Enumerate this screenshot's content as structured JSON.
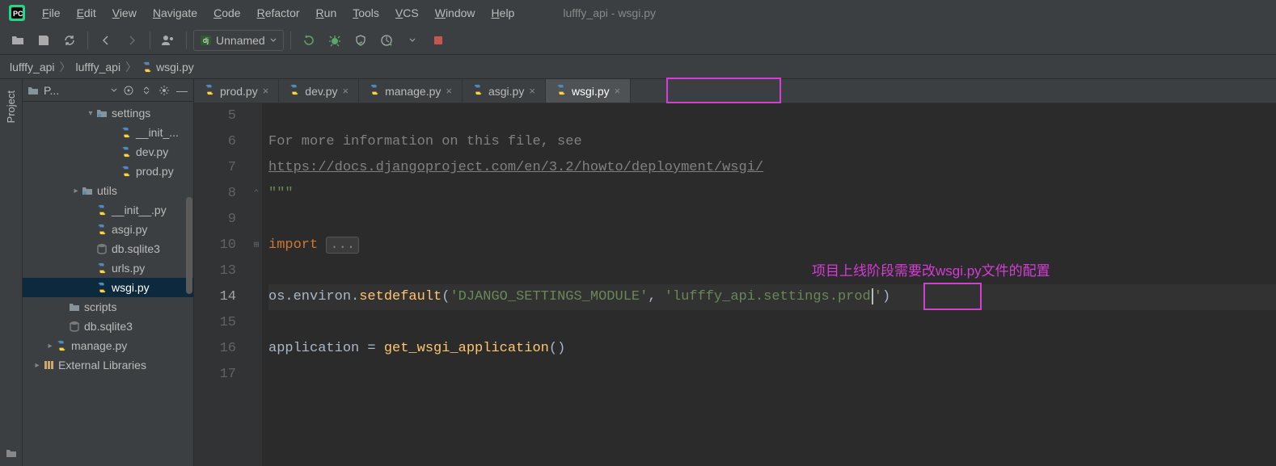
{
  "menu": {
    "items": [
      "File",
      "Edit",
      "View",
      "Navigate",
      "Code",
      "Refactor",
      "Run",
      "Tools",
      "VCS",
      "Window",
      "Help"
    ]
  },
  "window_title": "lufffy_api - wsgi.py",
  "run_config": {
    "label": "Unnamed",
    "badge": "dj"
  },
  "breadcrumbs": {
    "items": [
      "lufffy_api",
      "lufffy_api",
      "wsgi.py"
    ]
  },
  "project_panel": {
    "title": "P..."
  },
  "side_tab": {
    "label": "Project"
  },
  "tree": [
    {
      "pad": 78,
      "kind": "folder",
      "label": "settings",
      "arrow": "down"
    },
    {
      "pad": 108,
      "kind": "py",
      "label": "__init_..."
    },
    {
      "pad": 108,
      "kind": "py",
      "label": "dev.py"
    },
    {
      "pad": 108,
      "kind": "py",
      "label": "prod.py"
    },
    {
      "pad": 60,
      "kind": "folder",
      "label": "utils",
      "arrow": "right"
    },
    {
      "pad": 78,
      "kind": "py",
      "label": "__init__.py"
    },
    {
      "pad": 78,
      "kind": "py",
      "label": "asgi.py"
    },
    {
      "pad": 78,
      "kind": "db",
      "label": "db.sqlite3"
    },
    {
      "pad": 78,
      "kind": "py",
      "label": "urls.py"
    },
    {
      "pad": 78,
      "kind": "py",
      "label": "wsgi.py",
      "selected": true
    },
    {
      "pad": 44,
      "kind": "folder-plain",
      "label": "scripts"
    },
    {
      "pad": 44,
      "kind": "db",
      "label": "db.sqlite3"
    },
    {
      "pad": 28,
      "kind": "py",
      "label": "manage.py",
      "arrow": "right"
    },
    {
      "pad": 12,
      "kind": "lib",
      "label": "External Libraries",
      "arrow": "right"
    }
  ],
  "tabs": [
    {
      "label": "prod.py"
    },
    {
      "label": "dev.py"
    },
    {
      "label": "manage.py"
    },
    {
      "label": "asgi.py"
    },
    {
      "label": "wsgi.py",
      "active": true
    }
  ],
  "code": {
    "lines": [
      {
        "n": "5",
        "html": ""
      },
      {
        "n": "6",
        "html": "<span class='c-comment'>For more information on this file, see</span>"
      },
      {
        "n": "7",
        "html": "<span class='c-link'>https://docs.djangoproject.com/en/3.2/howto/deployment/wsgi/</span>"
      },
      {
        "n": "8",
        "html": "<span class='c-string'>\"\"\"</span>",
        "fold": "up"
      },
      {
        "n": "9",
        "html": ""
      },
      {
        "n": "10",
        "html": "<span class='c-keyword'>import</span> <span class='c-folded'>...</span>",
        "fold": "plus"
      },
      {
        "n": "13",
        "html": ""
      },
      {
        "n": "14",
        "html": "os.environ.<span class='c-func'>setdefault</span>(<span class='c-string'>'DJANGO_SETTINGS_MODULE'</span>, <span class='c-string'>'lufffy_api.settings.prod<span class='caret'></span>'</span>)",
        "current": true
      },
      {
        "n": "15",
        "html": ""
      },
      {
        "n": "16",
        "html": "application = <span class='c-func'>get_wsgi_application</span>()"
      },
      {
        "n": "17",
        "html": ""
      }
    ]
  },
  "annotation_text": "项目上线阶段需要改wsgi.py文件的配置"
}
